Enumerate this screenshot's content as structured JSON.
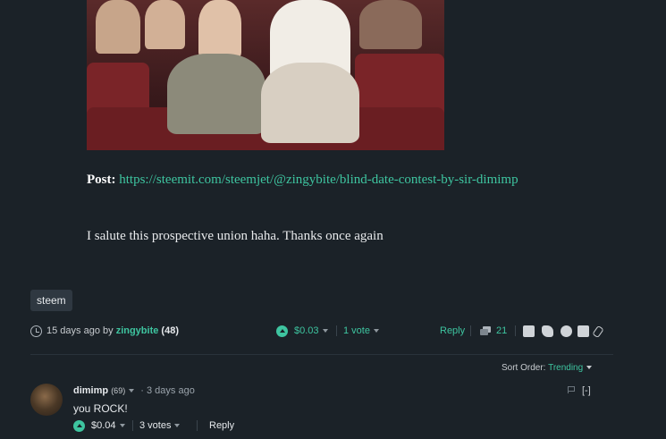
{
  "post": {
    "post_label": "Post:",
    "post_url": "https://steemit.com/steemjet/@zingybite/blind-date-contest-by-sir-dimimp",
    "message": "I salute this prospective union haha. Thanks once again"
  },
  "tag": "steem",
  "meta": {
    "time_ago": "15 days ago by",
    "author": "zingybite",
    "reputation": "(48)",
    "payout": "$0.03",
    "votes": "1 vote",
    "reply": "Reply",
    "comments_count": "21"
  },
  "sort": {
    "label": "Sort Order:",
    "value": "Trending"
  },
  "comment": {
    "author": "dimimp",
    "reputation": "(69)",
    "time": "3 days ago",
    "collapse": "[-]",
    "body": "you ROCK!",
    "payout": "$0.04",
    "votes": "3 votes",
    "reply": "Reply"
  },
  "colors": {
    "accent": "#3ec5a0",
    "background": "#1b2228"
  }
}
